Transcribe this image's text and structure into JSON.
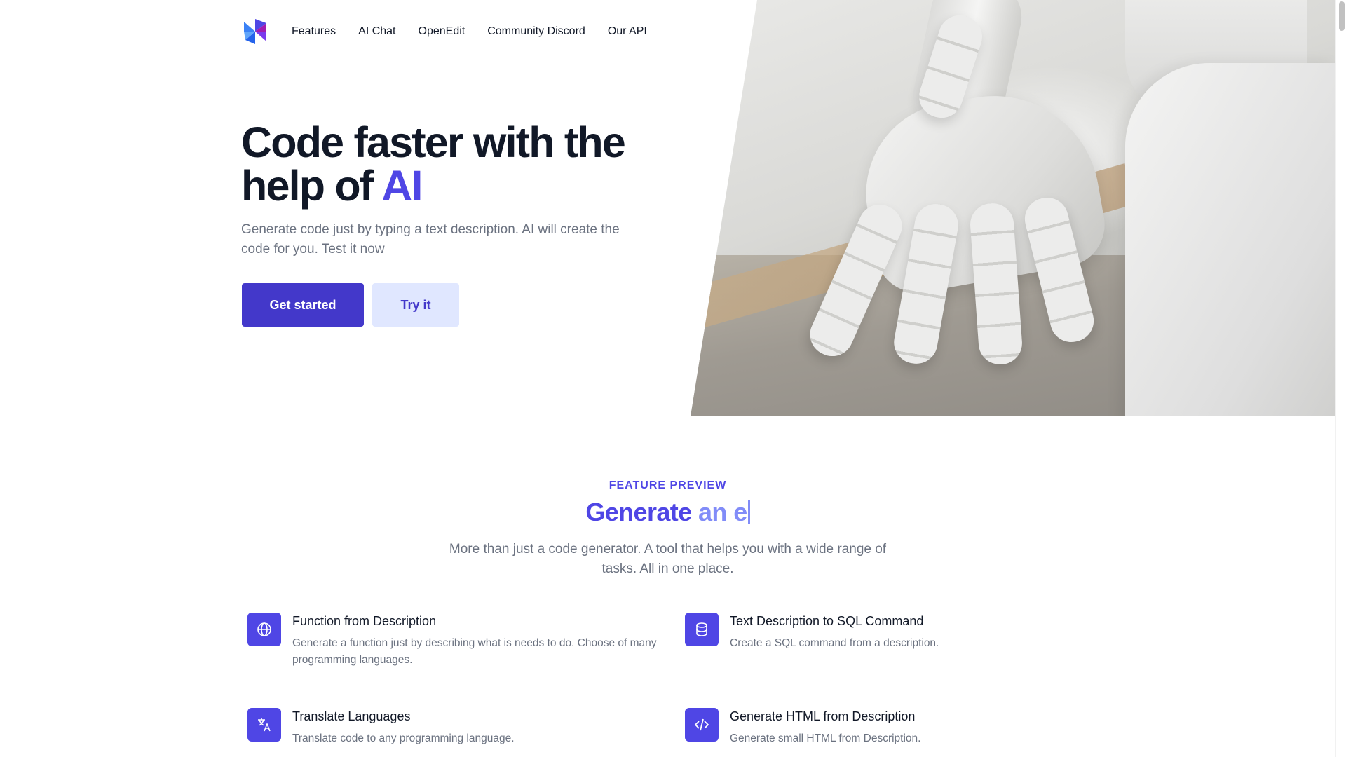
{
  "nav": {
    "logo": "site-logo",
    "links": [
      "Features",
      "AI Chat",
      "OpenEdit",
      "Community Discord",
      "Our API"
    ]
  },
  "hero": {
    "title_main": "Code faster with the help of",
    "title_accent": "AI",
    "subtitle": "Generate code just by typing a text description. AI will create the code for you. Test it now",
    "primary_button": "Get started",
    "secondary_button": "Try it",
    "image": "robot-hand-photo"
  },
  "features": {
    "eyebrow": "FEATURE PREVIEW",
    "title_static": "Generate",
    "title_typed": "an e",
    "description": "More than just a code generator. A tool that helps you with a wide range of tasks. All in one place.",
    "items": [
      {
        "icon": "globe-icon",
        "name": "Function from Description",
        "text": "Generate a function just by describing what is needs to do. Choose of many programming languages."
      },
      {
        "icon": "database-icon",
        "name": "Text Description to SQL Command",
        "text": "Create a SQL command from a description."
      },
      {
        "icon": "translate-icon",
        "name": "Translate Languages",
        "text": "Translate code to any programming language."
      },
      {
        "icon": "code-icon",
        "name": "Generate HTML from Description",
        "text": "Generate small HTML from Description."
      }
    ]
  },
  "colors": {
    "accent": "#4f46e5",
    "primary_button": "#4338ca",
    "secondary_button_bg": "#e0e7ff",
    "light_accent": "#818cf8",
    "muted_text": "#6b7280"
  }
}
